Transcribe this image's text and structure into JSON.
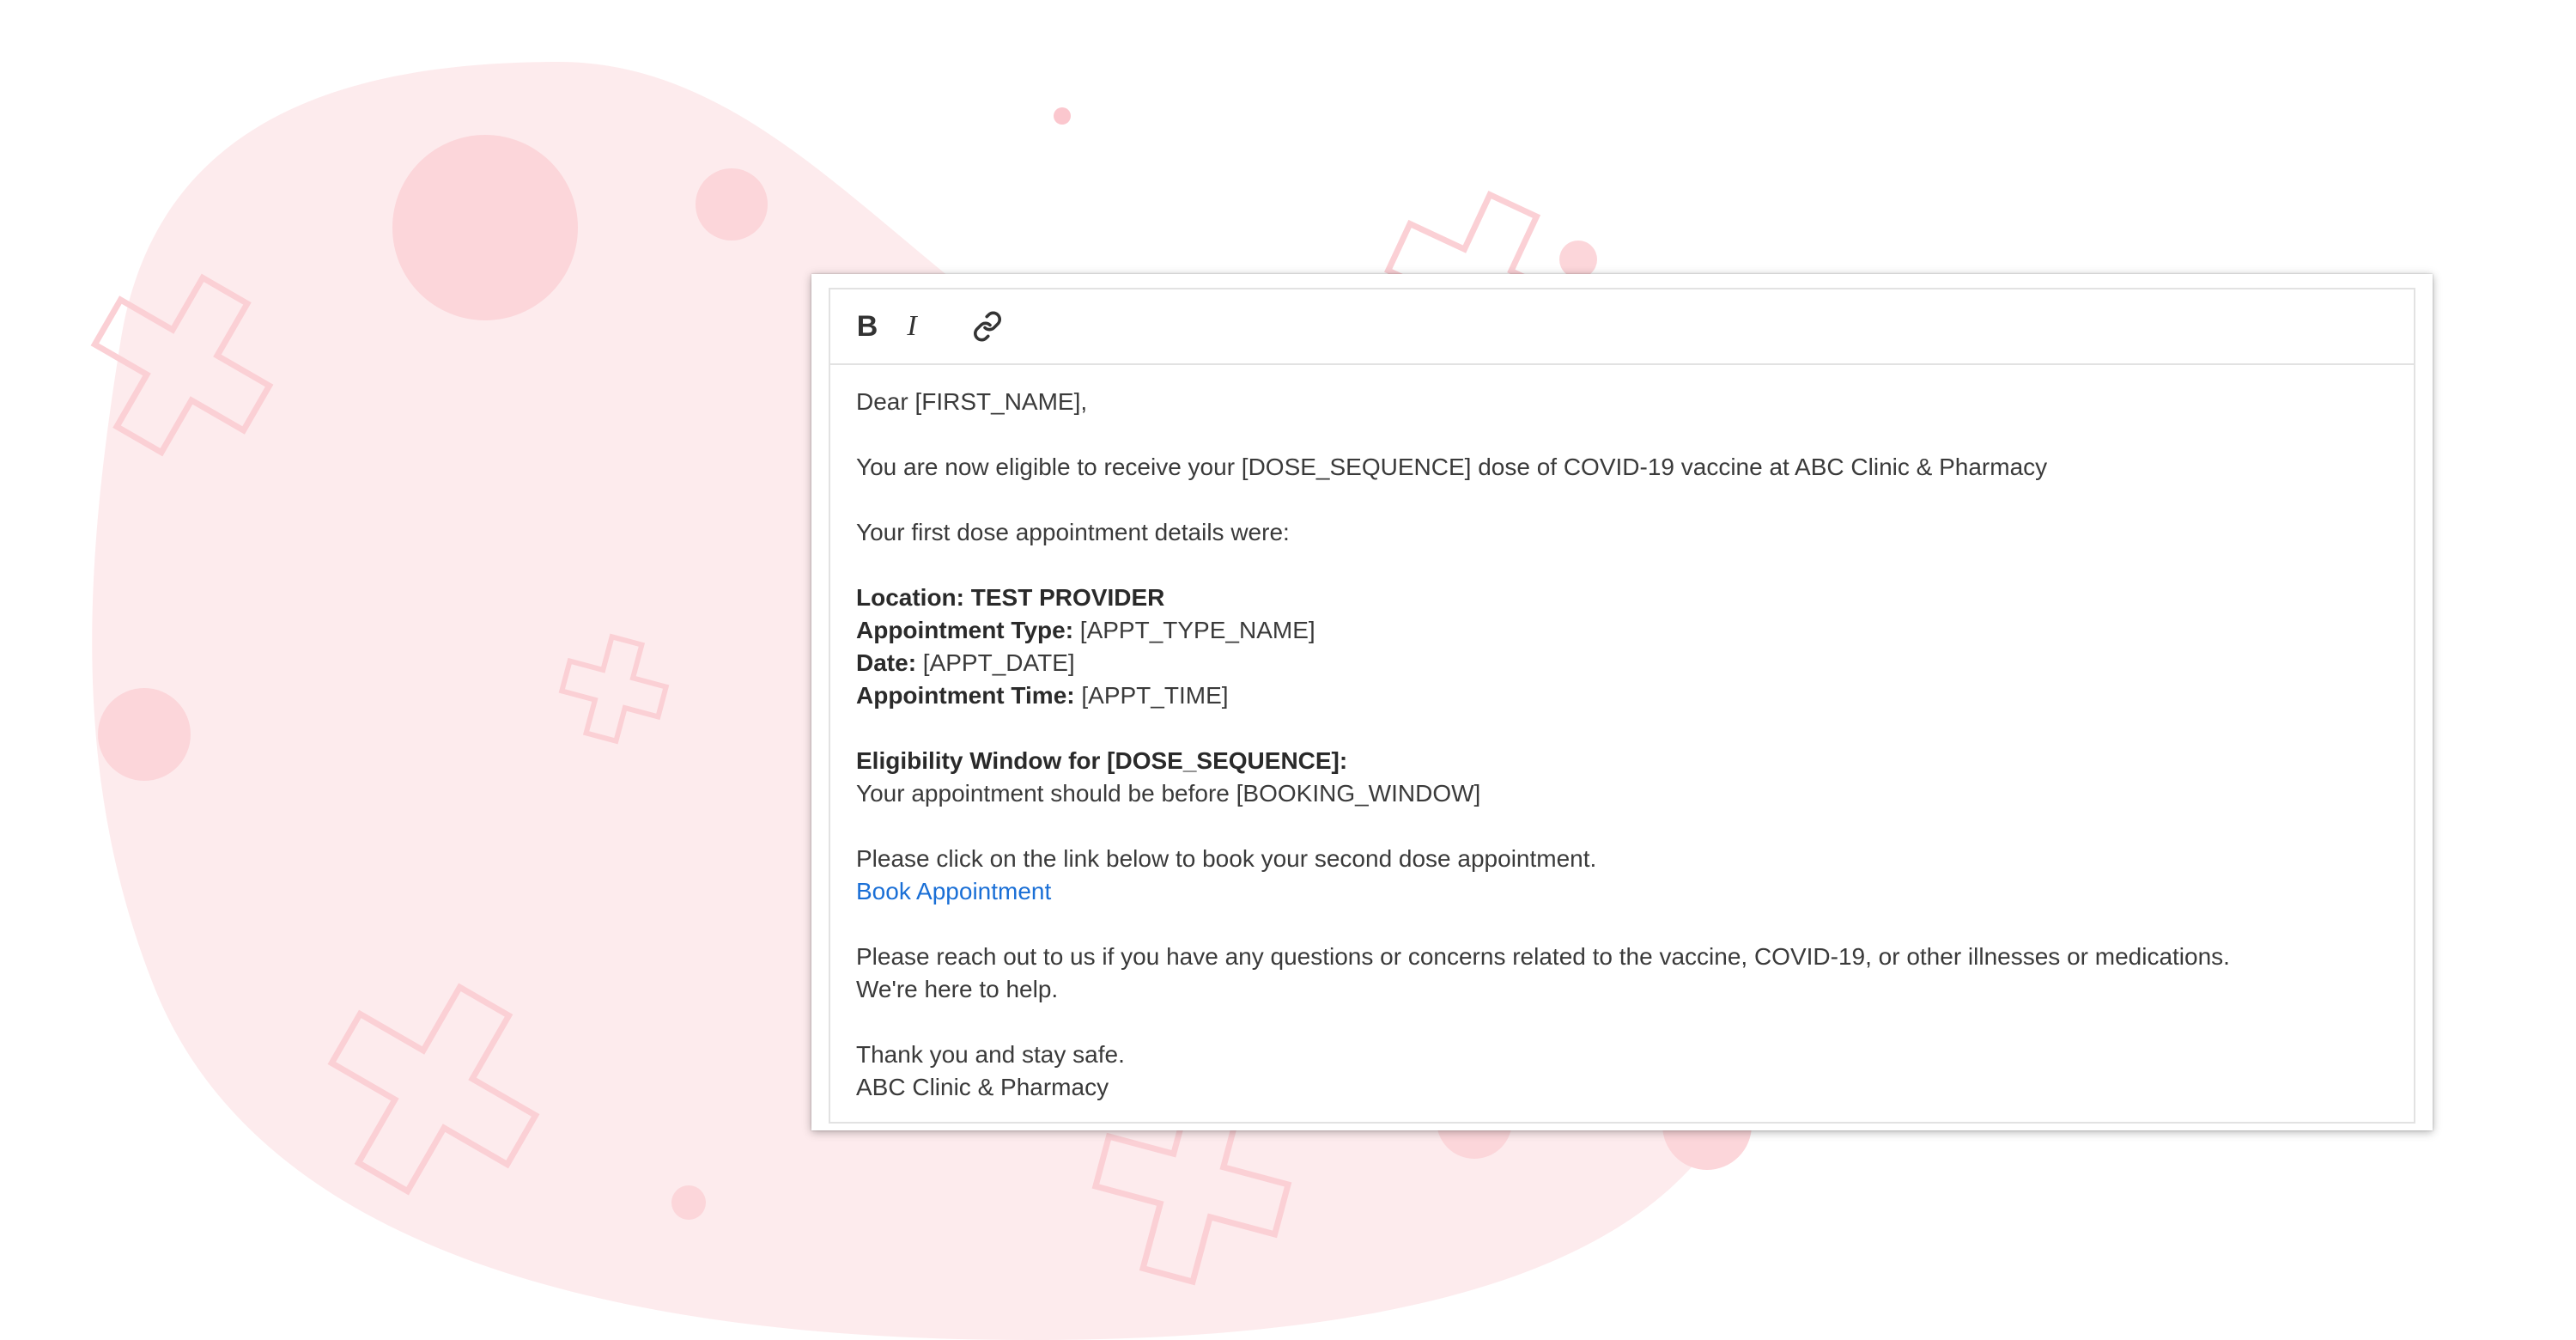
{
  "toolbar": {
    "bold_icon": "bold-icon",
    "italic_icon": "italic-icon",
    "link_icon": "link-icon",
    "bold_glyph": "B",
    "italic_glyph": "I"
  },
  "email": {
    "greeting": "Dear [FIRST_NAME],",
    "eligibility_line": "You are now eligible to receive your [DOSE_SEQUENCE] dose of COVID-19 vaccine at ABC Clinic & Pharmacy",
    "details_intro": "Your first dose appointment details were:",
    "location_label": "Location:",
    "location_value": "TEST PROVIDER",
    "appt_type_label": "Appointment Type:",
    "appt_type_value": "[APPT_TYPE_NAME]",
    "date_label": "Date:",
    "date_value": "[APPT_DATE]",
    "time_label": "Appointment Time:",
    "time_value": "[APPT_TIME]",
    "window_heading": "Eligibility Window for [DOSE_SEQUENCE]:",
    "window_text": "Your appointment should be before [BOOKING_WINDOW]",
    "click_text": "Please click on the link below to book your second dose appointment.",
    "book_link": "Book Appointment",
    "reach_out": "Please reach out to us if you have any questions or concerns related to the vaccine, COVID-19, or other illnesses or medications.",
    "here_to_help": "We're here to help.",
    "thanks": "Thank you and stay safe.",
    "signature": "ABC Clinic & Pharmacy"
  },
  "colors": {
    "blob": "#fdebed",
    "accent_pink": "#fbd3d8",
    "link_blue": "#1a6fd6"
  }
}
